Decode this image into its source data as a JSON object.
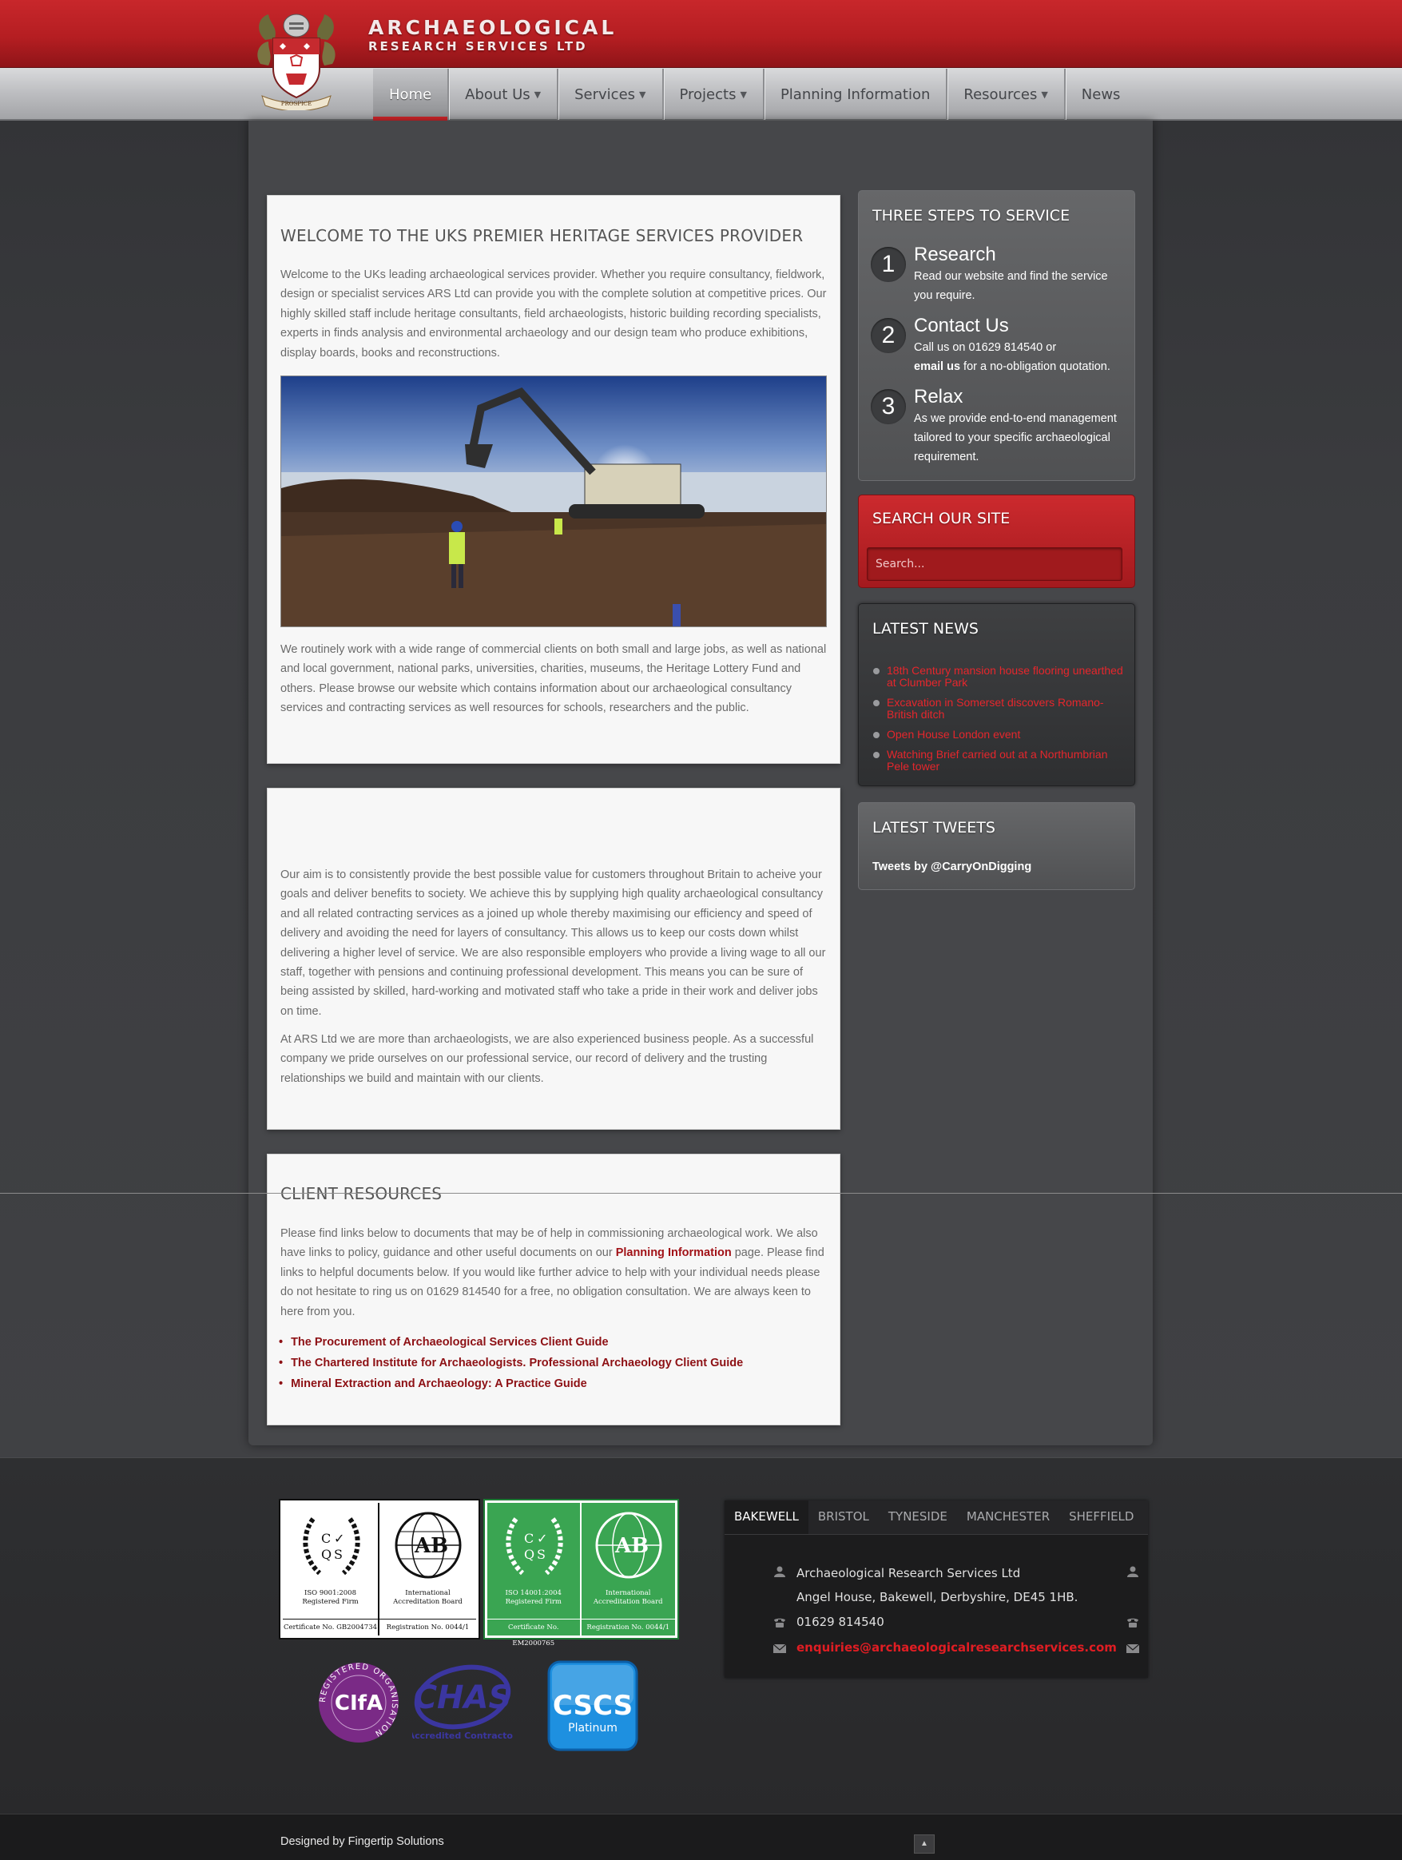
{
  "brand": {
    "title": "ARCHAEOLOGICAL",
    "subtitle": "RESEARCH SERVICES LTD",
    "motto": "PROSPICE"
  },
  "nav": [
    {
      "label": "Home",
      "active": true,
      "dropdown": false
    },
    {
      "label": "About Us",
      "active": false,
      "dropdown": true
    },
    {
      "label": "Services",
      "active": false,
      "dropdown": true
    },
    {
      "label": "Projects",
      "active": false,
      "dropdown": true
    },
    {
      "label": "Planning Information",
      "active": false,
      "dropdown": false
    },
    {
      "label": "Resources",
      "active": false,
      "dropdown": true
    },
    {
      "label": "News",
      "active": false,
      "dropdown": false
    }
  ],
  "welcome": {
    "heading": "WELCOME TO THE UKS PREMIER HERITAGE SERVICES PROVIDER",
    "intro": "Welcome to the UKs leading archaeological services provider. Whether you require consultancy, fieldwork, design or specialist services ARS Ltd can provide you with the complete solution at competitive prices. Our highly skilled staff include heritage consultants, field archaeologists, historic building recording specialists, experts in finds analysis and environmental archaeology and our design team who produce exhibitions, display boards, books and reconstructions.",
    "body": "We routinely work with a wide range of commercial clients on both small and large jobs, as well as national and local government, national parks, universities, charities, museums, the Heritage Lottery Fund and others. Please browse our website which contains information about our archaeological consultancy services and contracting services as well resources for schools, researchers and the public."
  },
  "aim": {
    "p1": "Our aim is to consistently provide the best possible value for customers throughout Britain to acheive your goals and deliver benefits to society. We achieve this by supplying high quality archaeological consultancy and all related contracting services as a joined up whole thereby maximising our efficiency and speed of delivery and avoiding the need for layers of consultancy. This allows us to keep our costs down whilst delivering a higher level of service. We are also responsible employers who provide a living wage to all our staff, together with pensions and continuing professional development. This means you can be sure of being assisted by skilled, hard-working and motivated staff who take a pride in their work and deliver jobs on time.",
    "p2": "At ARS Ltd we are more than archaeologists, we are also experienced business people. As a successful company we pride ourselves on our professional service, our record of delivery and the trusting relationships we build and maintain with our clients."
  },
  "client_resources": {
    "heading": "CLIENT RESOURCES",
    "text_before": "Please find links below to documents that may be of help in commissioning archaeological work. We also have links to policy, guidance and other useful documents on our ",
    "link": "Planning Information",
    "text_after": " page. Please find links to helpful documents below. If you would like further advice to help with your individual needs please do not hesitate to ring us on 01629 814540 for a free, no obligation consultation. We are always keen to here from you.",
    "links": [
      "The Procurement of Archaeological Services Client Guide",
      "The Chartered Institute for Archaeologists. Professional Archaeology Client Guide",
      "Mineral Extraction and Archaeology: A Practice Guide"
    ]
  },
  "three_steps": {
    "title": "THREE STEPS TO SERVICE",
    "steps": [
      {
        "num": "1",
        "title": "Research",
        "text": "Read our website and find the service you require."
      },
      {
        "num": "2",
        "title": "Contact Us",
        "text_before": "Call us on 01629 814540 or",
        "bold": "email us",
        "text_after": " for a no-obligation quotation."
      },
      {
        "num": "3",
        "title": "Relax",
        "text": "As we provide end-to-end management tailored to your specific archaeological requirement."
      }
    ]
  },
  "search": {
    "title": "SEARCH OUR SITE",
    "placeholder": "Search..."
  },
  "latest_news": {
    "title": "LATEST NEWS",
    "items": [
      "18th Century mansion house flooring unearthed at Clumber Park",
      "Excavation in Somerset discovers Romano-British ditch",
      "Open House London event",
      "Watching Brief carried out at a Northumbrian Pele tower"
    ]
  },
  "latest_tweets": {
    "title": "LATEST TWEETS",
    "link": "Tweets by @CarryOnDigging"
  },
  "certs": {
    "c1_left": "ISO 9001:2008\nRegistered Firm",
    "c1_right": "International\nAccreditation Board",
    "c1_foot_left": "Certificate No. GB2004734",
    "c1_foot_right": "Registration No. 0044/1",
    "c2_left": "ISO 14001:2004\nRegistered Firm",
    "c2_right": "International\nAccreditation Board",
    "c2_foot_left": "Certificate No. EM2000765",
    "c2_foot_right": "Registration No. 0044/1",
    "cifa_ring": "REGISTERED ORGANISATION",
    "cifa": "CIfA",
    "chas": "CHAS",
    "chas_sub": "Accredited Contractor",
    "cscs": "CSCS",
    "cscs_sub": "Platinum"
  },
  "offices": {
    "tabs": [
      "BAKEWELL",
      "BRISTOL",
      "TYNESIDE",
      "MANCHESTER",
      "SHEFFIELD"
    ],
    "company": "Archaeological Research Services Ltd",
    "address": "Angel House, Bakewell, Derbyshire, DE45 1HB.",
    "phone": "01629 814540",
    "email": "enquiries@archaeologicalresearchservices.com"
  },
  "footer": {
    "designed_by": "Designed by Fingertip Solutions"
  },
  "colors": {
    "brand_red": "#c8272b",
    "link_red": "#a11217",
    "news_red": "#e6262c"
  }
}
